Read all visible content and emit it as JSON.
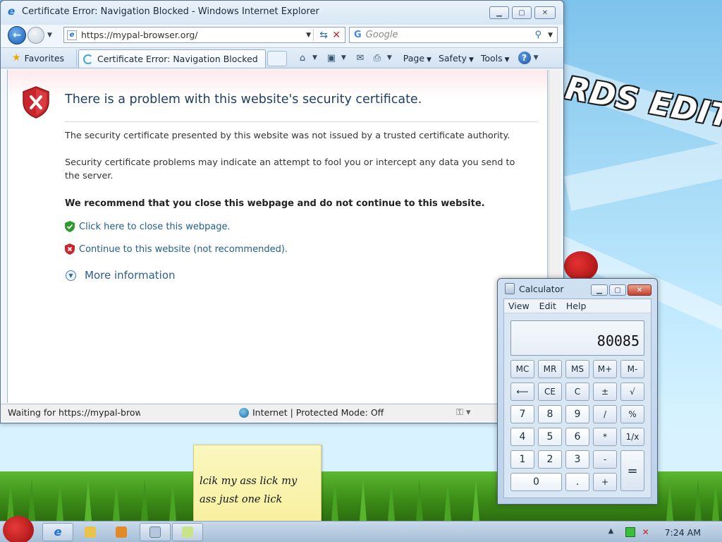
{
  "desktop": {
    "wallpaper_text": "RDS EDITION"
  },
  "ie": {
    "window_title": "Certificate Error: Navigation Blocked - Windows Internet Explorer",
    "address_url": "https://mypal-browser.org/",
    "search_placeholder": "Google",
    "favorites_label": "Favorites",
    "tab_label": "Certificate Error: Navigation Blocked",
    "toolbar": {
      "page": "Page",
      "safety": "Safety",
      "tools": "Tools"
    },
    "page": {
      "headline": "There is a problem with this website's security certificate.",
      "para1": "The security certificate presented by this website was not issued by a trusted certificate authority.",
      "para2": "Security certificate problems may indicate an attempt to fool you or intercept any data you send to the server.",
      "recommendation": "We recommend that you close this webpage and do not continue to this website.",
      "close_link": "Click here to close this webpage.",
      "continue_link": "Continue to this website (not recommended).",
      "more_info": "More information"
    },
    "status": {
      "text": "Waiting for https://mypal-brows",
      "zone": "Internet | Protected Mode: Off"
    }
  },
  "calculator": {
    "title": "Calculator",
    "menu": [
      "View",
      "Edit",
      "Help"
    ],
    "display": "80085",
    "keys": {
      "mc": "MC",
      "mr": "MR",
      "ms": "MS",
      "mplus": "M+",
      "mminus": "M-",
      "back": "⟵",
      "ce": "CE",
      "c": "C",
      "plusminus": "±",
      "sqrt": "√",
      "k7": "7",
      "k8": "8",
      "k9": "9",
      "div": "/",
      "pct": "%",
      "k4": "4",
      "k5": "5",
      "k6": "6",
      "mul": "*",
      "recip": "1/x",
      "k1": "1",
      "k2": "2",
      "k3": "3",
      "sub": "-",
      "eq": "=",
      "k0": "0",
      "dot": ".",
      "add": "+"
    }
  },
  "sticky_note": {
    "text": "lcik my ass lick my ass just one lick"
  },
  "taskbar": {
    "clock": "7:24 AM"
  },
  "colors": {
    "link": "#1f5e8d",
    "headline": "#1f3e62",
    "shield_red": "#c8262c",
    "shield_green": "#2e9a2e"
  }
}
